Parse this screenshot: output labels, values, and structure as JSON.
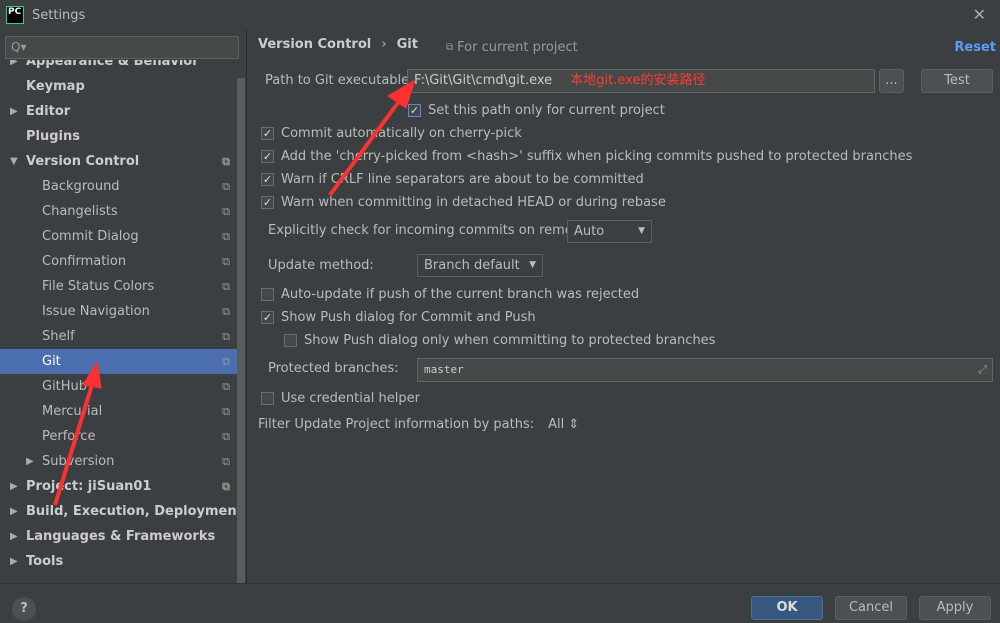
{
  "window": {
    "title": "Settings",
    "logo": "PC",
    "close_icon": "close-icon"
  },
  "sidebar": {
    "search_placeholder": "Q▾",
    "items": [
      {
        "label": "Appearance & Behavior",
        "level": 0,
        "bold": true,
        "arrow": "▶",
        "copy": false
      },
      {
        "label": "Keymap",
        "level": 0,
        "bold": true,
        "arrow": "",
        "copy": false
      },
      {
        "label": "Editor",
        "level": 0,
        "bold": true,
        "arrow": "▶",
        "copy": false
      },
      {
        "label": "Plugins",
        "level": 0,
        "bold": true,
        "arrow": "",
        "copy": false
      },
      {
        "label": "Version Control",
        "level": 0,
        "bold": true,
        "arrow": "▼",
        "copy": true
      },
      {
        "label": "Background",
        "level": 1,
        "copy": true
      },
      {
        "label": "Changelists",
        "level": 1,
        "copy": true
      },
      {
        "label": "Commit Dialog",
        "level": 1,
        "copy": true
      },
      {
        "label": "Confirmation",
        "level": 1,
        "copy": true
      },
      {
        "label": "File Status Colors",
        "level": 1,
        "copy": true
      },
      {
        "label": "Issue Navigation",
        "level": 1,
        "copy": true
      },
      {
        "label": "Shelf",
        "level": 1,
        "copy": true
      },
      {
        "label": "Git",
        "level": 1,
        "copy": true,
        "selected": true
      },
      {
        "label": "GitHub",
        "level": 1,
        "copy": true
      },
      {
        "label": "Mercurial",
        "level": 1,
        "copy": true
      },
      {
        "label": "Perforce",
        "level": 1,
        "copy": true
      },
      {
        "label": "Subversion",
        "level": 1,
        "copy": true,
        "arrow": "▶"
      },
      {
        "label": "Project: jiSuan01",
        "level": 0,
        "bold": true,
        "arrow": "▶",
        "copy": true
      },
      {
        "label": "Build, Execution, Deployment",
        "level": 0,
        "bold": true,
        "arrow": "▶"
      },
      {
        "label": "Languages & Frameworks",
        "level": 0,
        "bold": true,
        "arrow": "▶"
      },
      {
        "label": "Tools",
        "level": 0,
        "bold": true,
        "arrow": "▶"
      }
    ]
  },
  "header": {
    "crumb1": "Version Control",
    "sep": "›",
    "crumb2": "Git",
    "scope": "For current project",
    "reset": "Reset"
  },
  "git": {
    "path_label": "Path to Git executable:",
    "path_value": "F:\\Git\\Git\\cmd\\git.exe",
    "annotation": "本地git.exe的安装路径",
    "browse": "...",
    "test": "Test",
    "set_path_only": {
      "label": "Set this path only for current project",
      "checked": true
    },
    "checks": [
      {
        "label": "Commit automatically on cherry-pick",
        "checked": true
      },
      {
        "label": "Add the 'cherry-picked from <hash>' suffix when picking commits pushed to protected branches",
        "checked": true
      },
      {
        "label": "Warn if CRLF line separators are about to be committed",
        "checked": true
      },
      {
        "label": "Warn when committing in detached HEAD or during rebase",
        "checked": true
      }
    ],
    "incoming_label": "Explicitly check for incoming commits on remotes:",
    "incoming_value": "Auto",
    "update_label": "Update method:",
    "update_value": "Branch default",
    "auto_update": {
      "label": "Auto-update if push of the current branch was rejected",
      "checked": false
    },
    "show_push": {
      "label": "Show Push dialog for Commit and Push",
      "checked": true
    },
    "show_push_protected": {
      "label": "Show Push dialog only when committing to protected branches",
      "checked": false
    },
    "protected_label": "Protected branches:",
    "protected_value": "master",
    "credential": {
      "label": "Use credential helper",
      "checked": false
    },
    "filter_label": "Filter Update Project information by paths:",
    "filter_value": "All ⇕"
  },
  "footer": {
    "help": "?",
    "ok": "OK",
    "cancel": "Cancel",
    "apply": "Apply"
  },
  "colors": {
    "selection": "#4b6eaf",
    "ok_button": "#365880",
    "annotation": "#ff3b30",
    "link": "#589df6"
  }
}
